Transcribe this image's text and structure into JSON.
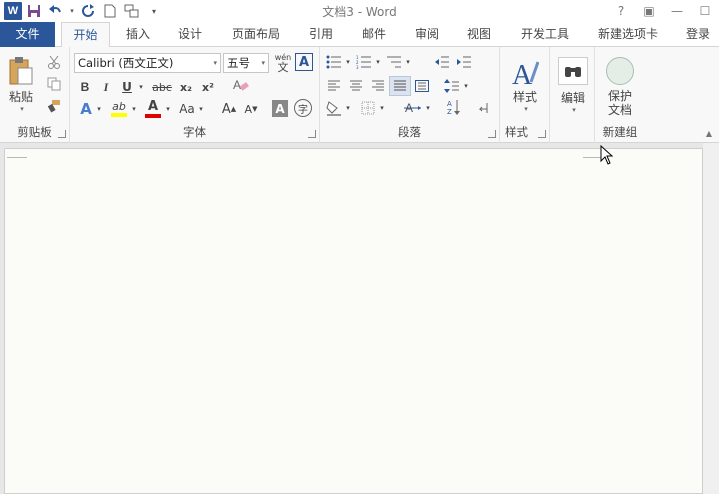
{
  "app": {
    "title": "文档3 - Word",
    "logo": "W"
  },
  "qat": {
    "icons": [
      "word-logo-icon",
      "save-icon",
      "undo-icon",
      "redo-icon",
      "new-doc-icon",
      "touch-mode-icon",
      "customize-icon"
    ]
  },
  "window": {
    "help": "?",
    "ribbon_display": "▣",
    "minimize": "—",
    "maximize": "☐"
  },
  "tabs": [
    {
      "label": "文件"
    },
    {
      "label": "开始"
    },
    {
      "label": "插入"
    },
    {
      "label": "设计"
    },
    {
      "label": "页面布局"
    },
    {
      "label": "引用"
    },
    {
      "label": "邮件"
    },
    {
      "label": "审阅"
    },
    {
      "label": "视图"
    },
    {
      "label": "开发工具"
    },
    {
      "label": "新建选项卡"
    },
    {
      "label": "登录"
    }
  ],
  "ribbon": {
    "clipboard": {
      "label": "剪贴板",
      "paste": "粘贴"
    },
    "font": {
      "label": "字体",
      "font_name": "Calibri (西文正文)",
      "font_size": "五号",
      "wen": "wén",
      "wen_char": "文",
      "char_border": "A",
      "bold": "B",
      "italic": "I",
      "underline": "U",
      "strike": "abc",
      "subscript": "x₂",
      "superscript": "x²",
      "text_effects": "A",
      "highlight": "ab",
      "font_color": "A",
      "change_case": "Aa",
      "grow": "A",
      "shrink": "A",
      "char_shading": "A",
      "enclose": "字"
    },
    "paragraph": {
      "label": "段落"
    },
    "styles": {
      "label": "样式",
      "button": "样式"
    },
    "editing": {
      "button": "编辑"
    },
    "newgroup": {
      "label": "新建组",
      "protect_line1": "保护",
      "protect_line2": "文档"
    }
  },
  "colors": {
    "accent": "#2b579a",
    "highlight_yellow": "#ffff00",
    "font_red": "#e00000"
  }
}
